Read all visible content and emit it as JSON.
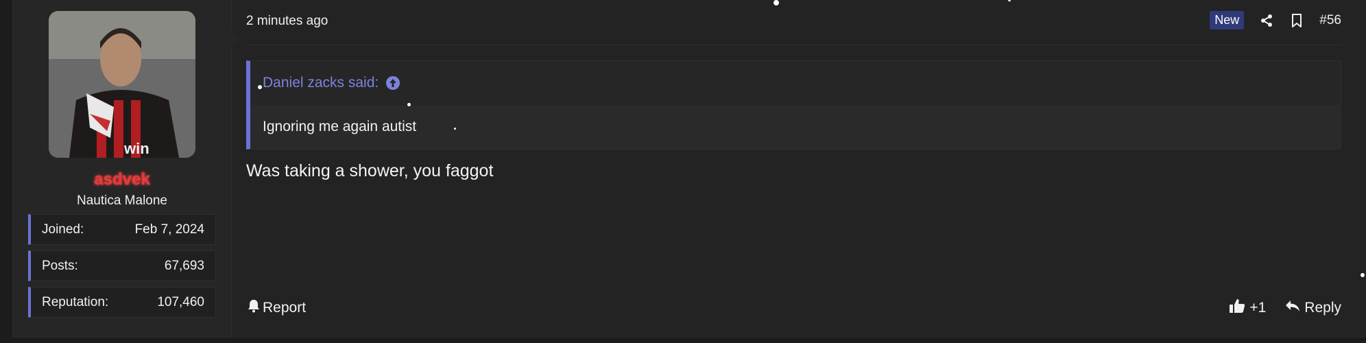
{
  "post": {
    "time": "2 minutes ago",
    "new_badge": "New",
    "number": "#56",
    "body": "Was taking a shower, you faggot"
  },
  "user": {
    "name": "asdvek",
    "title": "Nautica Malone",
    "stats": [
      {
        "label": "Joined:",
        "value": "Feb 7, 2024"
      },
      {
        "label": "Posts:",
        "value": "67,693"
      },
      {
        "label": "Reputation:",
        "value": "107,460"
      }
    ]
  },
  "quote": {
    "author_line": "Daniel zacks said:",
    "text": "Ignoring me again autist"
  },
  "footer": {
    "report_label": "Report",
    "like_count": "+1",
    "reply_label": "Reply"
  },
  "colors": {
    "accent": "#6b72d6",
    "username": "#e23b3b",
    "badge": "#2f3a78",
    "background": "#1c1c1c"
  },
  "icons": {
    "share": "share-icon",
    "bookmark": "bookmark-icon",
    "quote_jump": "arrow-up-circle-icon",
    "report": "bell-icon",
    "like": "thumbs-up-icon",
    "reply": "reply-arrow-icon"
  }
}
